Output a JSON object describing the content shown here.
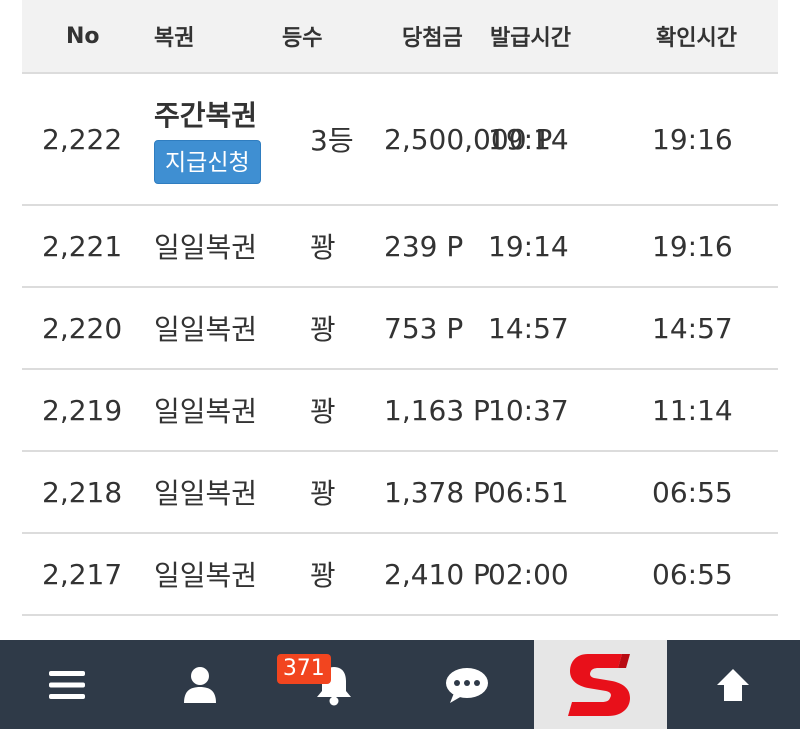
{
  "table": {
    "headers": [
      "No",
      "복권",
      "등수",
      "당첨금",
      "발급시간",
      "확인시간"
    ],
    "rows": [
      {
        "no": "2,222",
        "lottery": "주간복권",
        "rank": "3등",
        "prize": "2,500,000 P",
        "issued": "19:14",
        "checked": "19:16",
        "claim_label": "지급신청"
      },
      {
        "no": "2,221",
        "lottery": "일일복권",
        "rank": "꽝",
        "prize": "239 P",
        "issued": "19:14",
        "checked": "19:16"
      },
      {
        "no": "2,220",
        "lottery": "일일복권",
        "rank": "꽝",
        "prize": "753 P",
        "issued": "14:57",
        "checked": "14:57"
      },
      {
        "no": "2,219",
        "lottery": "일일복권",
        "rank": "꽝",
        "prize": "1,163 P",
        "issued": "10:37",
        "checked": "11:14"
      },
      {
        "no": "2,218",
        "lottery": "일일복권",
        "rank": "꽝",
        "prize": "1,378 P",
        "issued": "06:51",
        "checked": "06:55"
      },
      {
        "no": "2,217",
        "lottery": "일일복권",
        "rank": "꽝",
        "prize": "2,410 P",
        "issued": "02:00",
        "checked": "06:55"
      }
    ]
  },
  "bottom_bar": {
    "items": [
      {
        "icon": "hamburger-menu-icon"
      },
      {
        "icon": "user-icon"
      },
      {
        "icon": "bell-icon",
        "badge": "371"
      },
      {
        "icon": "chat-bubble-icon"
      },
      {
        "icon": "s-logo"
      },
      {
        "icon": "arrow-up-icon"
      }
    ]
  },
  "colors": {
    "header_bg": "#f2f2f2",
    "claim_button": "#3f8fd2",
    "bottom_bar_bg": "#2f3a48",
    "badge_bg": "#f2451f",
    "logo_red": "#e8101a"
  }
}
